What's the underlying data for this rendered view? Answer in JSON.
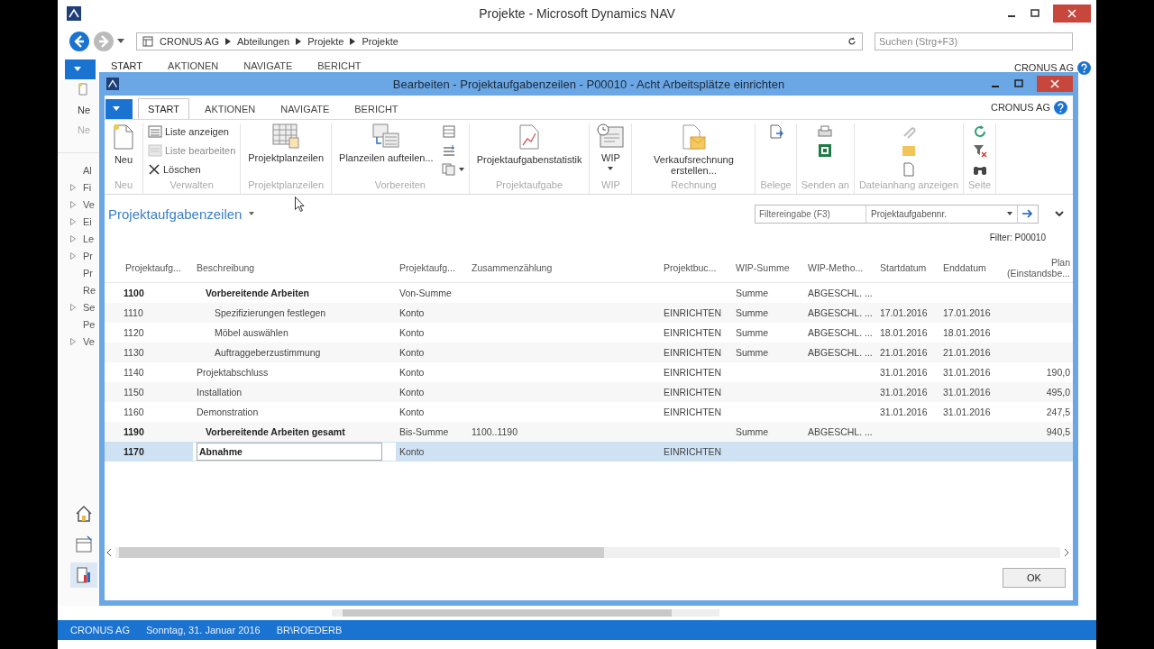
{
  "window": {
    "title": "Projekte - Microsoft Dynamics NAV"
  },
  "address_bar": {
    "breadcrumb": [
      "CRONUS AG",
      "Abteilungen",
      "Projekte",
      "Projekte"
    ]
  },
  "search": {
    "placeholder": "Suchen (Strg+F3)"
  },
  "tabs": [
    {
      "label": "START",
      "selected": true
    },
    {
      "label": "AKTIONEN",
      "selected": false
    },
    {
      "label": "NAVIGATE",
      "selected": false
    },
    {
      "label": "BERICHT",
      "selected": false
    }
  ],
  "company": "CRONUS AG",
  "left_pane": {
    "ribbon_button": "Ne",
    "ribbon_group": "Ne",
    "items": [
      {
        "label": "Al",
        "kind": "link"
      },
      {
        "label": "Fi",
        "kind": "group"
      },
      {
        "label": "Ve",
        "kind": "group"
      },
      {
        "label": "Ei",
        "kind": "group"
      },
      {
        "label": "Le",
        "kind": "group"
      },
      {
        "label": "Pr",
        "kind": "group"
      },
      {
        "label": "Pr",
        "kind": "link"
      },
      {
        "label": "Re",
        "kind": "link"
      },
      {
        "label": "Se",
        "kind": "group"
      },
      {
        "label": "Pe",
        "kind": "link"
      },
      {
        "label": "Ve",
        "kind": "group"
      }
    ],
    "nav_buttons": [
      {
        "selected": false
      },
      {
        "selected": false
      },
      {
        "selected": true
      }
    ]
  },
  "status_bar": [
    "CRONUS AG",
    "Sonntag, 31. Januar 2016",
    "BR\\ROEDERB"
  ],
  "dialog": {
    "title": "Bearbeiten - Projektaufgabenzeilen - P00010 - Acht Arbeitsplätze einrichten",
    "tabs": [
      {
        "label": "START",
        "selected": true
      },
      {
        "label": "AKTIONEN",
        "selected": false
      },
      {
        "label": "NAVIGATE",
        "selected": false
      },
      {
        "label": "BERICHT",
        "selected": false
      }
    ],
    "company": "CRONUS AG",
    "ribbon": [
      {
        "label": "Neu",
        "buttons": [
          {
            "kind": "large",
            "label": "Neu",
            "disabled": false
          }
        ]
      },
      {
        "label": "Verwalten",
        "buttons": [
          {
            "kind": "small",
            "label": "Liste anzeigen",
            "disabled": false
          },
          {
            "kind": "small",
            "label": "Liste bearbeiten",
            "disabled": true
          },
          {
            "kind": "small",
            "label": "Löschen",
            "disabled": false
          }
        ]
      },
      {
        "label": "Projektplanzeilen",
        "buttons": [
          {
            "kind": "large",
            "label": "Projektplanzeilen",
            "disabled": false
          }
        ]
      },
      {
        "label": "Vorbereiten",
        "buttons": [
          {
            "kind": "large",
            "label": "Planzeilen aufteilen...",
            "disabled": false
          },
          {
            "kind": "icon",
            "disabled": false
          },
          {
            "kind": "icon",
            "disabled": false
          },
          {
            "kind": "icon_menu",
            "disabled": false
          }
        ]
      },
      {
        "label": "Projektaufgabe",
        "buttons": [
          {
            "kind": "large",
            "label": "Projektaufgabenstatistik",
            "disabled": false
          }
        ]
      },
      {
        "label": "WIP",
        "buttons": [
          {
            "kind": "large_menu",
            "label": "WIP",
            "disabled": false
          }
        ]
      },
      {
        "label": "Rechnung",
        "buttons": [
          {
            "kind": "large",
            "label": "Verkaufsrechnung erstellen...",
            "disabled": false
          }
        ]
      },
      {
        "label": "Belege",
        "buttons": [
          {
            "kind": "icon",
            "disabled": false
          }
        ]
      },
      {
        "label": "Senden an",
        "buttons": [
          {
            "kind": "icon",
            "disabled": false
          },
          {
            "kind": "icon",
            "disabled": false
          }
        ]
      },
      {
        "label": "Dateianhang anzeigen",
        "buttons": [
          {
            "kind": "icon",
            "disabled": true
          },
          {
            "kind": "icon",
            "disabled": false
          },
          {
            "kind": "icon",
            "disabled": false
          }
        ]
      },
      {
        "label": "Seite",
        "buttons": [
          {
            "kind": "icon",
            "disabled": false
          },
          {
            "kind": "icon",
            "disabled": false
          },
          {
            "kind": "icon",
            "disabled": false
          }
        ]
      }
    ],
    "page_title": "Projektaufgabenzeilen",
    "filter": {
      "placeholder": "Filtereingabe (F3)",
      "field": "Projektaufgabennr."
    },
    "filter_text": "Filter: P00010",
    "table": {
      "columns": [
        "Projektaufg...",
        "Beschreibung",
        "Projektaufg...",
        "Zusammenzählung",
        "Projektbuc...",
        "WIP-Summe",
        "WIP-Metho...",
        "Startdatum",
        "Enddatum",
        "Plan\n(Einstandsbe..."
      ],
      "rows": [
        {
          "kind": "total",
          "selected": false,
          "cells": {
            "no": "1100",
            "description": "Vorbereitende Arbeiten",
            "type": "Von-Summe",
            "wip_total": "Summe",
            "wip_method": "ABGESCHL. ..."
          }
        },
        {
          "kind": "sub",
          "selected": false,
          "cells": {
            "no": "1110",
            "description": "Spezifizierungen festlegen",
            "type": "Konto",
            "posting_group": "EINRICHTEN",
            "wip_total": "Summe",
            "wip_method": "ABGESCHL. ...",
            "start": "17.01.2016",
            "end": "17.01.2016"
          }
        },
        {
          "kind": "sub",
          "selected": false,
          "cells": {
            "no": "1120",
            "description": "Möbel auswählen",
            "type": "Konto",
            "posting_group": "EINRICHTEN",
            "wip_total": "Summe",
            "wip_method": "ABGESCHL. ...",
            "start": "18.01.2016",
            "end": "18.01.2016"
          }
        },
        {
          "kind": "sub",
          "selected": false,
          "cells": {
            "no": "1130",
            "description": "Auftraggeberzustimmung",
            "type": "Konto",
            "posting_group": "EINRICHTEN",
            "wip_total": "Summe",
            "wip_method": "ABGESCHL. ...",
            "start": "21.01.2016",
            "end": "21.01.2016"
          }
        },
        {
          "kind": "task",
          "selected": false,
          "cells": {
            "no": "1140",
            "description": "Projektabschluss",
            "type": "Konto",
            "posting_group": "EINRICHTEN",
            "start": "31.01.2016",
            "end": "31.01.2016",
            "plan_cost": "190,0"
          }
        },
        {
          "kind": "task",
          "selected": false,
          "cells": {
            "no": "1150",
            "description": "Installation",
            "type": "Konto",
            "posting_group": "EINRICHTEN",
            "start": "31.01.2016",
            "end": "31.01.2016",
            "plan_cost": "495,0"
          }
        },
        {
          "kind": "task",
          "selected": false,
          "cells": {
            "no": "1160",
            "description": "Demonstration",
            "type": "Konto",
            "posting_group": "EINRICHTEN",
            "start": "31.01.2016",
            "end": "31.01.2016",
            "plan_cost": "247,5"
          }
        },
        {
          "kind": "total",
          "selected": false,
          "cells": {
            "no": "1190",
            "description": "Vorbereitende Arbeiten gesamt",
            "type": "Bis-Summe",
            "totaling": "1100..1190",
            "wip_total": "Summe",
            "wip_method": "ABGESCHL. ...",
            "plan_cost": "940,5"
          }
        },
        {
          "kind": "editing",
          "selected": true,
          "cells": {
            "no": "1170",
            "description": "Abnahme",
            "type": "Konto",
            "posting_group": "EINRICHTEN"
          }
        }
      ]
    },
    "ok_button": "OK"
  }
}
